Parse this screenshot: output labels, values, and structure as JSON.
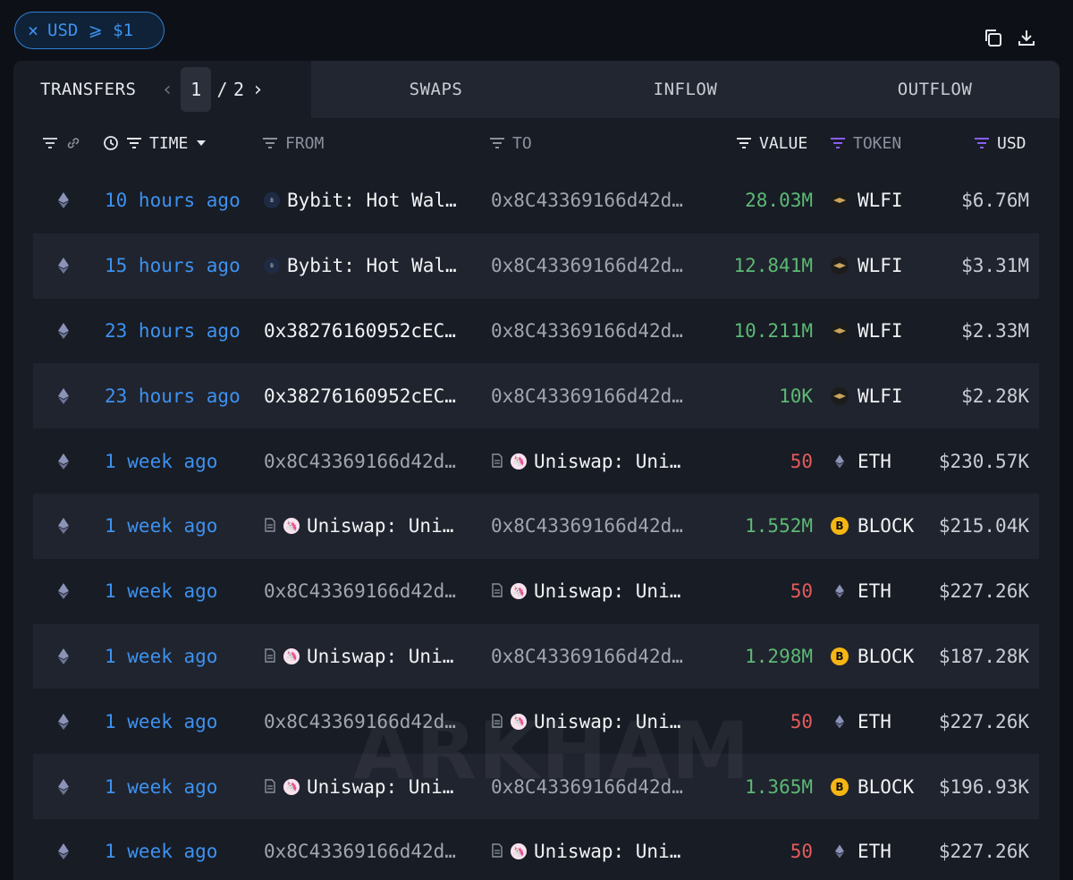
{
  "filter_chip": {
    "label": "USD ⩾ $1"
  },
  "top_actions": {
    "copy_icon": "copy-icon",
    "download_icon": "download-icon"
  },
  "tabs": {
    "transfers": "TRANSFERS",
    "page_current": "1",
    "page_sep": "/",
    "page_total": "2",
    "swaps": "SWAPS",
    "inflow": "INFLOW",
    "outflow": "OUTFLOW"
  },
  "columns": {
    "time": "TIME",
    "from": "FROM",
    "to": "TO",
    "value": "VALUE",
    "token": "TOKEN",
    "usd": "USD"
  },
  "colors": {
    "accent_blue": "#3d92f0",
    "positive": "#5cb975",
    "negative": "#e55b5b",
    "filter_purple": "#8b5cf6"
  },
  "rows": [
    {
      "time": "10 hours ago",
      "from": "Bybit: Hot Wal…",
      "from_type": "bybit",
      "to": "0x8C43369166d42d…",
      "to_type": "addr",
      "value": "28.03M",
      "dir": "pos",
      "token": "WLFI",
      "usd": "$6.76M"
    },
    {
      "time": "15 hours ago",
      "from": "Bybit: Hot Wal…",
      "from_type": "bybit",
      "to": "0x8C43369166d42d…",
      "to_type": "addr",
      "value": "12.841M",
      "dir": "pos",
      "token": "WLFI",
      "usd": "$3.31M"
    },
    {
      "time": "23 hours ago",
      "from": "0x38276160952cEC…",
      "from_type": "addr-white",
      "to": "0x8C43369166d42d…",
      "to_type": "addr",
      "value": "10.211M",
      "dir": "pos",
      "token": "WLFI",
      "usd": "$2.33M"
    },
    {
      "time": "23 hours ago",
      "from": "0x38276160952cEC…",
      "from_type": "addr-white",
      "to": "0x8C43369166d42d…",
      "to_type": "addr",
      "value": "10K",
      "dir": "pos",
      "token": "WLFI",
      "usd": "$2.28K"
    },
    {
      "time": "1 week ago",
      "from": "0x8C43369166d42d…",
      "from_type": "addr",
      "to": "Uniswap: Uni…",
      "to_type": "uniswap",
      "value": "50",
      "dir": "neg",
      "token": "ETH",
      "usd": "$230.57K"
    },
    {
      "time": "1 week ago",
      "from": "Uniswap: Uni…",
      "from_type": "uniswap",
      "to": "0x8C43369166d42d…",
      "to_type": "addr",
      "value": "1.552M",
      "dir": "pos",
      "token": "BLOCK",
      "usd": "$215.04K"
    },
    {
      "time": "1 week ago",
      "from": "0x8C43369166d42d…",
      "from_type": "addr",
      "to": "Uniswap: Uni…",
      "to_type": "uniswap",
      "value": "50",
      "dir": "neg",
      "token": "ETH",
      "usd": "$227.26K"
    },
    {
      "time": "1 week ago",
      "from": "Uniswap: Uni…",
      "from_type": "uniswap",
      "to": "0x8C43369166d42d…",
      "to_type": "addr",
      "value": "1.298M",
      "dir": "pos",
      "token": "BLOCK",
      "usd": "$187.28K"
    },
    {
      "time": "1 week ago",
      "from": "0x8C43369166d42d…",
      "from_type": "addr",
      "to": "Uniswap: Uni…",
      "to_type": "uniswap",
      "value": "50",
      "dir": "neg",
      "token": "ETH",
      "usd": "$227.26K"
    },
    {
      "time": "1 week ago",
      "from": "Uniswap: Uni…",
      "from_type": "uniswap",
      "to": "0x8C43369166d42d…",
      "to_type": "addr",
      "value": "1.365M",
      "dir": "pos",
      "token": "BLOCK",
      "usd": "$196.93K"
    },
    {
      "time": "1 week ago",
      "from": "0x8C43369166d42d…",
      "from_type": "addr",
      "to": "Uniswap: Uni…",
      "to_type": "uniswap",
      "value": "50",
      "dir": "neg",
      "token": "ETH",
      "usd": "$227.26K"
    }
  ]
}
